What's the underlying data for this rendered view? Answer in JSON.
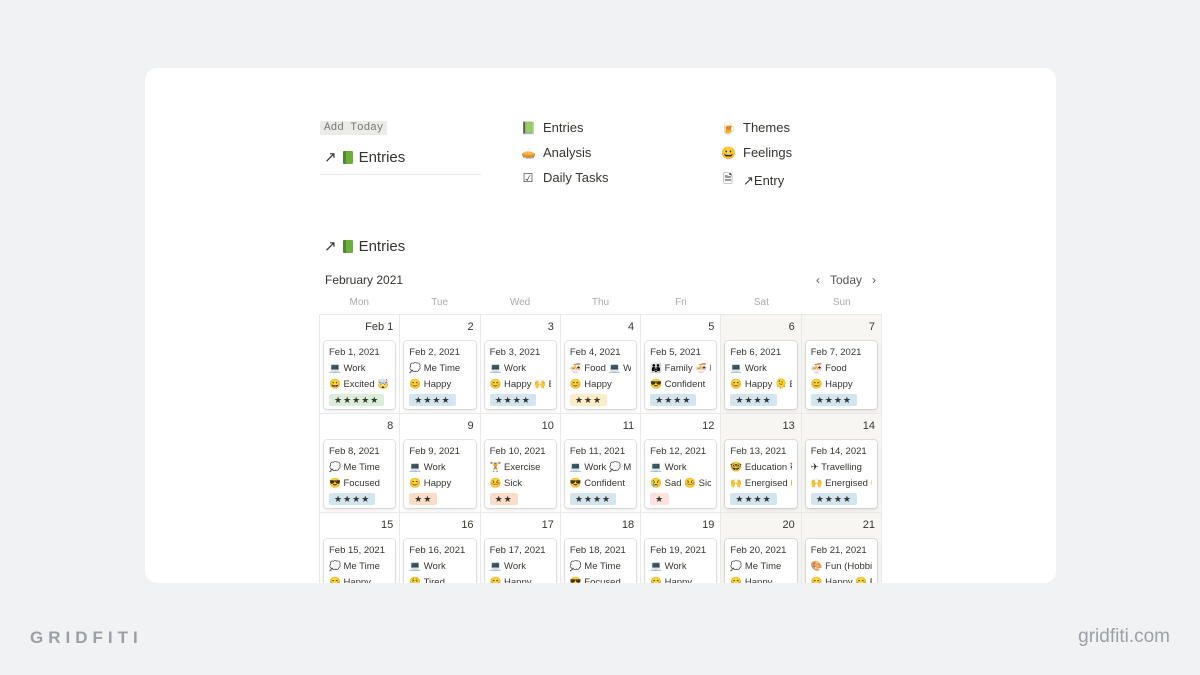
{
  "header": {
    "add_today": "Add Today",
    "linked_title": "Entries",
    "arrow": "↗"
  },
  "nav": [
    {
      "icon": "book-icon",
      "glyph": "📗",
      "label": "Entries"
    },
    {
      "icon": "pie-icon",
      "glyph": "🥧",
      "label": "Analysis"
    },
    {
      "icon": "checkbox-icon",
      "glyph": "☑",
      "label": "Daily Tasks"
    },
    {
      "icon": "beer-icon",
      "glyph": "🍺",
      "label": "Themes"
    },
    {
      "icon": "smile-icon",
      "glyph": "😀",
      "label": "Feelings"
    },
    {
      "icon": "page-icon",
      "glyph": "🗎",
      "label": "↗Entry"
    }
  ],
  "calendar": {
    "section_title": "Entries",
    "month": "February 2021",
    "today": "Today",
    "prev": "‹",
    "next": "›",
    "weekdays": [
      "Mon",
      "Tue",
      "Wed",
      "Thu",
      "Fri",
      "Sat",
      "Sun"
    ],
    "star_colors": {
      "5": "#dbeddb",
      "4": "#d3e5ef",
      "3": "#fdecc8",
      "2": "#fadec9",
      "1": "#ffe2dd"
    },
    "days": [
      {
        "n": "Feb 1",
        "title": "Feb 1, 2021",
        "theme": "💻 Work",
        "feeling": "😀 Excited 🤯",
        "rating": 5,
        "stars": "★★★★★"
      },
      {
        "n": "2",
        "title": "Feb 2, 2021",
        "theme": "💭 Me Time",
        "feeling": "😊 Happy",
        "rating": 4,
        "stars": "★★★★"
      },
      {
        "n": "3",
        "title": "Feb 3, 2021",
        "theme": "💻 Work",
        "feeling": "😊 Happy 🙌 E",
        "rating": 4,
        "stars": "★★★★"
      },
      {
        "n": "4",
        "title": "Feb 4, 2021",
        "theme": "🍜 Food 💻 Work",
        "feeling": "😊 Happy",
        "rating": 3,
        "stars": "★★★"
      },
      {
        "n": "5",
        "title": "Feb 5, 2021",
        "theme": "👪 Family 🍜 Food",
        "feeling": "😎 Confident",
        "rating": 4,
        "stars": "★★★★"
      },
      {
        "n": "6",
        "title": "Feb 6, 2021",
        "theme": "💻 Work",
        "feeling": "😊 Happy 🫠 E",
        "rating": 4,
        "stars": "★★★★"
      },
      {
        "n": "7",
        "title": "Feb 7, 2021",
        "theme": "🍜 Food",
        "feeling": "😊 Happy",
        "rating": 4,
        "stars": "★★★★"
      },
      {
        "n": "8",
        "title": "Feb 8, 2021",
        "theme": "💭 Me Time",
        "feeling": "😎 Focused",
        "rating": 4,
        "stars": "★★★★"
      },
      {
        "n": "9",
        "title": "Feb 9, 2021",
        "theme": "💻 Work",
        "feeling": "😊 Happy",
        "rating": 2,
        "stars": "★★"
      },
      {
        "n": "10",
        "title": "Feb 10, 2021",
        "theme": "🏋 Exercise",
        "feeling": "🤒 Sick",
        "rating": 2,
        "stars": "★★"
      },
      {
        "n": "11",
        "title": "Feb 11, 2021",
        "theme": "💻 Work 💭 Me Time",
        "feeling": "😎 Confident",
        "rating": 4,
        "stars": "★★★★"
      },
      {
        "n": "12",
        "title": "Feb 12, 2021",
        "theme": "💻 Work",
        "feeling": "😢 Sad 🤒 Sick",
        "rating": 1,
        "stars": "★"
      },
      {
        "n": "13",
        "title": "Feb 13, 2021",
        "theme": "🤓 Education 📚",
        "feeling": "🙌 Energised 😊",
        "rating": 4,
        "stars": "★★★★"
      },
      {
        "n": "14",
        "title": "Feb 14, 2021",
        "theme": "✈ Travelling",
        "feeling": "🙌 Energised 😊",
        "rating": 4,
        "stars": "★★★★"
      },
      {
        "n": "15",
        "title": "Feb 15, 2021",
        "theme": "💭 Me Time",
        "feeling": "😊 Happy"
      },
      {
        "n": "16",
        "title": "Feb 16, 2021",
        "theme": "💻 Work",
        "feeling": "😩 Tired"
      },
      {
        "n": "17",
        "title": "Feb 17, 2021",
        "theme": "💻 Work",
        "feeling": "😊 Happy"
      },
      {
        "n": "18",
        "title": "Feb 18, 2021",
        "theme": "💭 Me Time",
        "feeling": "😎 Focused"
      },
      {
        "n": "19",
        "title": "Feb 19, 2021",
        "theme": "💻 Work",
        "feeling": "😊 Happy"
      },
      {
        "n": "20",
        "title": "Feb 20, 2021",
        "theme": "💭 Me Time",
        "feeling": "😊 Happy"
      },
      {
        "n": "21",
        "title": "Feb 21, 2021",
        "theme": "🎨 Fun (Hobbies)",
        "feeling": "😊 Happy 😊 E"
      }
    ]
  },
  "footer": {
    "brand": "GRIDFITI",
    "site": "gridfiti.com"
  }
}
